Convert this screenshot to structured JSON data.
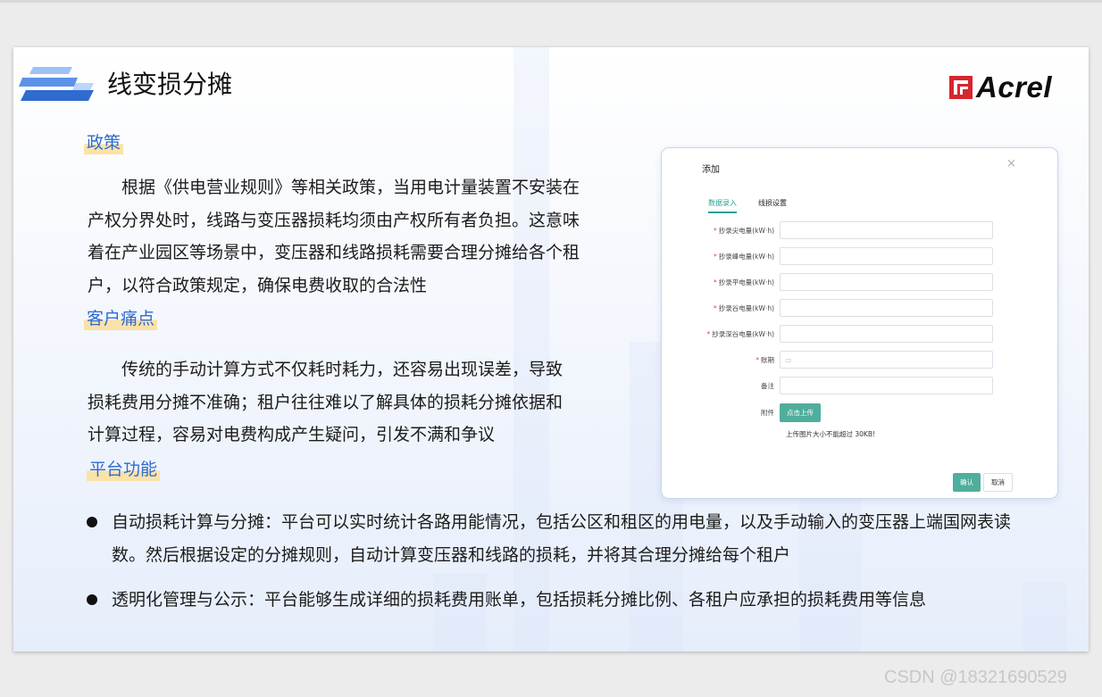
{
  "slide": {
    "title": "线变损分摊",
    "logo_text": "Acrel",
    "accent_color": "#2f6bd0",
    "highlight_color": "#fbe2a8"
  },
  "sections": {
    "policy": {
      "heading": "政策",
      "lines": [
        "根据《供电营业规则》等相关政策，当用电计量装置不安装在",
        "产权分界处时，线路与变压器损耗均须由产权所有者负担。这意味",
        "着在产业园区等场景中，变压器和线路损耗需要合理分摊给各个租",
        "户，以符合政策规定，确保电费收取的合法性"
      ]
    },
    "pain": {
      "heading": "客户痛点",
      "lines": [
        "传统的手动计算方式不仅耗时耗力，还容易出现误差，导致",
        "损耗费用分摊不准确；租户往往难以了解具体的损耗分摊依据和",
        "计算过程，容易对电费构成产生疑问，引发不满和争议"
      ]
    },
    "platform": {
      "heading": "平台功能",
      "bullets": [
        {
          "lines": [
            "自动损耗计算与分摊：平台可以实时统计各路用能情况，包括公区和租区的用电量，以及手动输入的变压器上端国网表读",
            "数。然后根据设定的分摊规则，自动计算变压器和线路的损耗，并将其合理分摊给每个租户"
          ]
        },
        {
          "lines": [
            "透明化管理与公示：平台能够生成详细的损耗费用账单，包括损耗分摊比例、各租户应承担的损耗费用等信息"
          ]
        }
      ]
    }
  },
  "dialog": {
    "title": "添加",
    "close_icon": "×",
    "tabs": [
      "数据录入",
      "线损设置"
    ],
    "fields": [
      {
        "label": "抄录尖电量(kW·h)",
        "required": "*"
      },
      {
        "label": "抄录峰电量(kW·h)",
        "required": "*"
      },
      {
        "label": "抄录平电量(kW·h)",
        "required": "*"
      },
      {
        "label": "抄录谷电量(kW·h)",
        "required": "*"
      },
      {
        "label": "抄录深谷电量(kW·h)",
        "required": "*"
      },
      {
        "label": "账期",
        "required": "*"
      },
      {
        "label": "备注",
        "required": ""
      },
      {
        "label": "附件",
        "required": ""
      }
    ],
    "upload_button": "点击上传",
    "upload_tip": "上传图片大小不能超过 30KB!",
    "confirm_button": "确认",
    "cancel_button": "取消"
  },
  "watermark": "CSDN @18321690529"
}
